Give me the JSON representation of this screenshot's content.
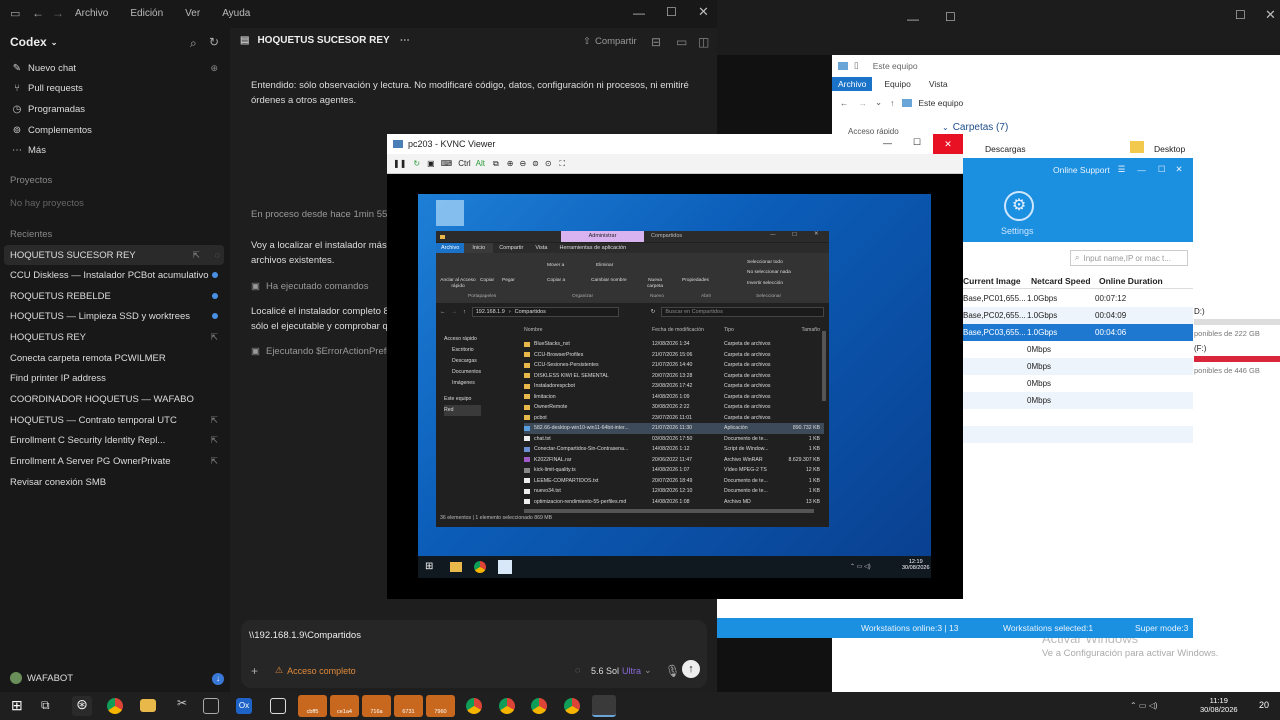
{
  "codex": {
    "menu": [
      "Archivo",
      "Edición",
      "Ver",
      "Ayuda"
    ],
    "brand": "Codex",
    "nav": [
      {
        "label": "Nuevo chat",
        "icon": "compose-icon"
      },
      {
        "label": "Pull requests",
        "icon": "pull-request-icon"
      },
      {
        "label": "Programadas",
        "icon": "clock-icon"
      },
      {
        "label": "Complementos",
        "icon": "plugin-icon"
      },
      {
        "label": "Más",
        "icon": "more-icon"
      }
    ],
    "projects_heading": "Proyectos",
    "projects_empty": "No hay proyectos",
    "recent_heading": "Recientes",
    "recent": [
      "HOQUETUS SUCESOR REY",
      "CCU Diskless — Instalador PCBot acumulativo",
      "ROQUETUS REBELDE",
      "HOQUETUS — Limpieza SSD y worktrees",
      "HOQUETUS REY",
      "Conecta carpeta remota PCWILMER",
      "Find printer IP address",
      "COORDINADOR HOQUETUS — WAFABO",
      "HOQUETUS — Contrato temporal UTC",
      "Enrollment C Security Identity Repl...",
      "Enrollment A Server PG OwnerPrivate",
      "Revisar conexión SMB"
    ],
    "user": "WAFABOT",
    "chat_title": "HOQUETUS SUCESOR REY",
    "share": "Compartir",
    "messages": {
      "m1_l1": "Entendido: sólo observación y lectura. No modificaré código, datos, configuración ni procesos, ni emitiré",
      "m1_l2": "órdenes a otros agentes.",
      "progress": "En proceso desde hace 1min 55s",
      "m2_l1": "Voy a localizar el instalador más r",
      "m2_l2": "archivos existentes.",
      "ran": "Ha ejecutado comandos",
      "m3_l1": "Localicé el instalador completo 8.",
      "m3_l2": "sólo el ejecutable y comprobar qu",
      "running": "Ejecutando $ErrorActionPrefe"
    },
    "composer": {
      "text": "\\\\192.168.1.9\\Compartidos",
      "access": "Acceso completo",
      "model": "5.6 Sol",
      "mode": "Ultra"
    }
  },
  "explorer": {
    "title": "Este equipo",
    "tabs": [
      "Archivo",
      "Equipo",
      "Vista"
    ],
    "address": "Este equipo",
    "quick_access": "Acceso rápido",
    "folders_heading": "Carpetas (7)",
    "folders": [
      "Descargas",
      "Desktop"
    ],
    "drive_d": "D:)",
    "drive_d_free": "ponibles de 222 GB",
    "drive_f": "(F:)",
    "drive_f_free": "ponibles de 446 GB",
    "watermark_1": "Activar Windows",
    "watermark_2": "Ve a Configuración para activar Windows."
  },
  "support": {
    "title": "Online Support",
    "settings": "Settings",
    "search_placeholder": "Input name,IP or mac t...",
    "columns": [
      "Current Image",
      "Netcard Speed",
      "Online Duration"
    ],
    "rows": [
      [
        "Base,PC01,655...",
        "1.0Gbps",
        "00:07:12"
      ],
      [
        "Base,PC02,655...",
        "1.0Gbps",
        "00:04:09"
      ],
      [
        "Base,PC03,655...",
        "1.0Gbps",
        "00:04:06"
      ],
      [
        "",
        "0Mbps",
        ""
      ],
      [
        "",
        "0Mbps",
        ""
      ],
      [
        "",
        "0Mbps",
        ""
      ],
      [
        "",
        "0Mbps",
        ""
      ]
    ],
    "status_online": "Workstations online:3 | 13",
    "status_selected": "Workstations selected:1",
    "status_mode": "Super mode:3"
  },
  "vnc": {
    "title": "pc203 - KVNC Viewer",
    "toolbar": [
      "Ctrl",
      "Alt"
    ],
    "remote_explorer": {
      "ribbon_tab_highlight": "Administrar",
      "ribbon_tab_right": "Compartidos",
      "ribbon_tabs": [
        "Archivo",
        "Inicio",
        "Compartir",
        "Vista",
        "Herramientas de aplicación"
      ],
      "ribbon_left": [
        "Anclar al Acceso rápido",
        "Copiar",
        "Pegar"
      ],
      "ribbon_org": [
        "Mover a",
        "Copiar a",
        "Eliminar",
        "Cambiar nombre"
      ],
      "ribbon_new": "Nueva carpeta",
      "ribbon_props": "Propiedades",
      "ribbon_select": [
        "Seleccionar todo",
        "No seleccionar nada",
        "Invertir selección"
      ],
      "groups": [
        "Portapapeles",
        "Organizar",
        "Nuevo",
        "Abrir",
        "Seleccionar"
      ],
      "path_ip": "192.168.1.9",
      "path_folder": "Compartidos",
      "search": "Buscar en Compartidos",
      "nav": [
        "Acceso rápido",
        "Escritorio",
        "Descargas",
        "Documentos",
        "Imágenes",
        "Este equipo",
        "Red"
      ],
      "headers": [
        "Nombre",
        "Fecha de modificación",
        "Tipo",
        "Tamaño"
      ],
      "files": [
        [
          "BlueStacks_nxt",
          "12/08/2026 1:34",
          "Carpeta de archivos",
          ""
        ],
        [
          "CCU-BrowserProfiles",
          "21/07/2026 15:06",
          "Carpeta de archivos",
          ""
        ],
        [
          "CCU-Sesiones-Persistentes",
          "21/07/2026 14:40",
          "Carpeta de archivos",
          ""
        ],
        [
          "DISKLESS KIWI EL SEMENTAL",
          "20/07/2026 13:28",
          "Carpeta de archivos",
          ""
        ],
        [
          "Instaladorespcbot",
          "23/08/2026 17:42",
          "Carpeta de archivos",
          ""
        ],
        [
          "limitacion",
          "14/08/2026 1:09",
          "Carpeta de archivos",
          ""
        ],
        [
          "OwnerRemote",
          "30/08/2026 2:22",
          "Carpeta de archivos",
          ""
        ],
        [
          "pcbot",
          "23/07/2026 11:01",
          "Carpeta de archivos",
          ""
        ],
        [
          "582.66-desktop-win10-win11-64bit-inter...",
          "21/07/2026 11:30",
          "Aplicación",
          "890.732 KB"
        ],
        [
          "chat.txt",
          "03/08/2026 17:50",
          "Documento de te...",
          "1 KB"
        ],
        [
          "Conectar-Compartidos-Sin-Contrasena...",
          "14/08/2026 1:12",
          "Script de Window...",
          "1 KB"
        ],
        [
          "K2022FINAL.rar",
          "20/06/2022 11:47",
          "Archivo WinRAR",
          "8.629.307 KB"
        ],
        [
          "kick-limit-quality.ts",
          "14/08/2026 1:07",
          "Vídeo MPEG-2 TS",
          "12 KB"
        ],
        [
          "LEEME-COMPARTIDOS.txt",
          "20/07/2026 18:49",
          "Documento de te...",
          "1 KB"
        ],
        [
          "nuevo34.txt",
          "12/08/2026 12:10",
          "Documento de te...",
          "1 KB"
        ],
        [
          "optimizacion-rendimiento-55-perfiles.md",
          "14/08/2026 1:08",
          "Archivo MD",
          "13 KB"
        ]
      ],
      "status": "36 elementos  |  1 elemento seleccionado  869 MB"
    },
    "remote_time": "12:19",
    "remote_date": "30/08/2026"
  },
  "taskbar": {
    "apps": [
      "cbff5",
      "ce1a4",
      "716a",
      "6731",
      "7960"
    ],
    "time": "11:19",
    "date": "30/08/2026",
    "corner": "20"
  }
}
